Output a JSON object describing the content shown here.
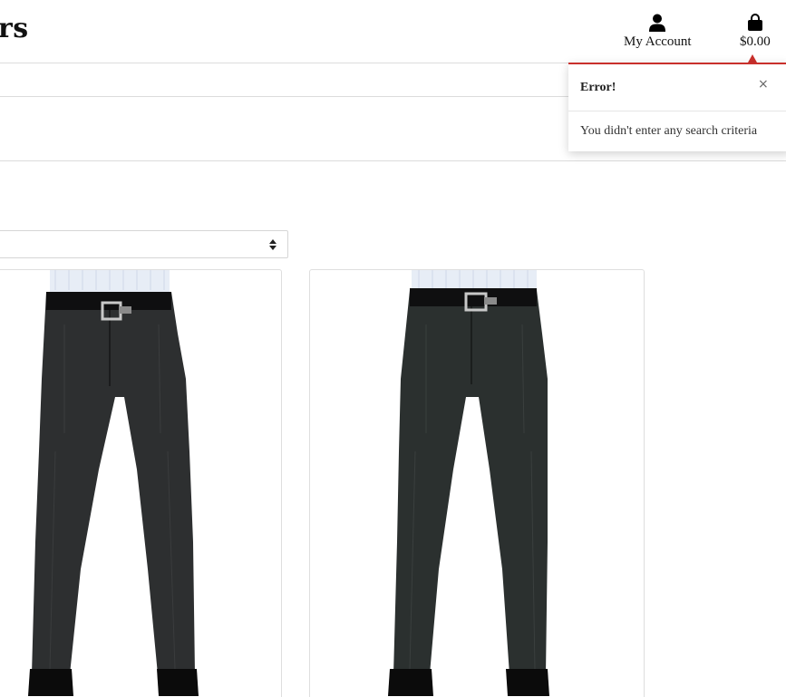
{
  "header": {
    "brand_partial": "rs",
    "account_label": "My Account",
    "cart_total": "$0.00"
  },
  "toast": {
    "title": "Error!",
    "close_glyph": "×",
    "message": "You didn't enter any search criteria",
    "accent_color": "#c9302c"
  },
  "icons": {
    "account": "user-icon",
    "cart": "shopping-bag-icon",
    "sort": "sort-caret-icon"
  },
  "products": [
    {
      "name": "product-card-1"
    },
    {
      "name": "product-card-2"
    }
  ]
}
